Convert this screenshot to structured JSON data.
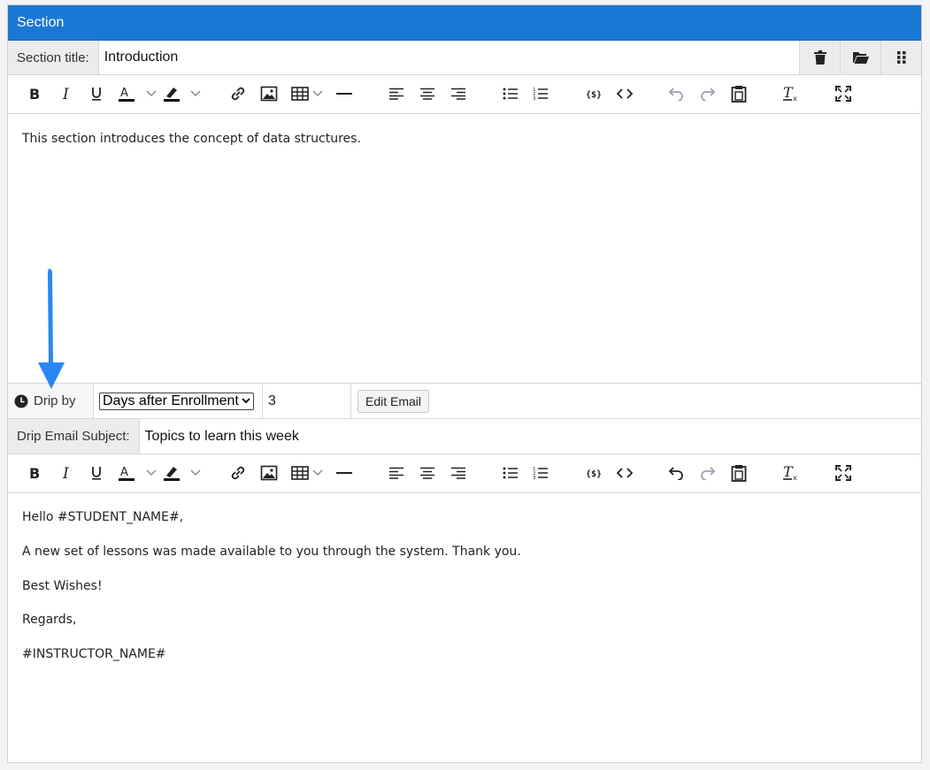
{
  "panel": {
    "header_title": "Section",
    "section_title_label": "Section title:",
    "section_title_value": "Introduction",
    "header_buttons": [
      "trash-icon",
      "folder-open-icon",
      "grip-icon"
    ]
  },
  "toolbar_icons": [
    "bold",
    "italic",
    "underline",
    "text-color",
    "highlight-color",
    "link",
    "image",
    "table",
    "horizontal-rule",
    "align-left",
    "align-center",
    "align-right",
    "bulleted-list",
    "numbered-list",
    "variable",
    "source-code",
    "undo",
    "redo",
    "paste",
    "clear-format",
    "fullscreen"
  ],
  "editor1": {
    "text": "This section introduces the concept of data structures."
  },
  "drip": {
    "label": "Drip by",
    "select_value": "Days after Enrollment",
    "days_value": "3",
    "edit_email_label": "Edit Email"
  },
  "email": {
    "subject_label": "Drip Email Subject:",
    "subject_value": "Topics to learn this week",
    "body": [
      "Hello #STUDENT_NAME#,",
      "A new set of lessons was made available to you through the system. Thank you.",
      "Best Wishes!",
      "Regards,",
      "#INSTRUCTOR_NAME#"
    ]
  },
  "colors": {
    "header": "#1a78d4",
    "arrow": "#2a86f5"
  }
}
